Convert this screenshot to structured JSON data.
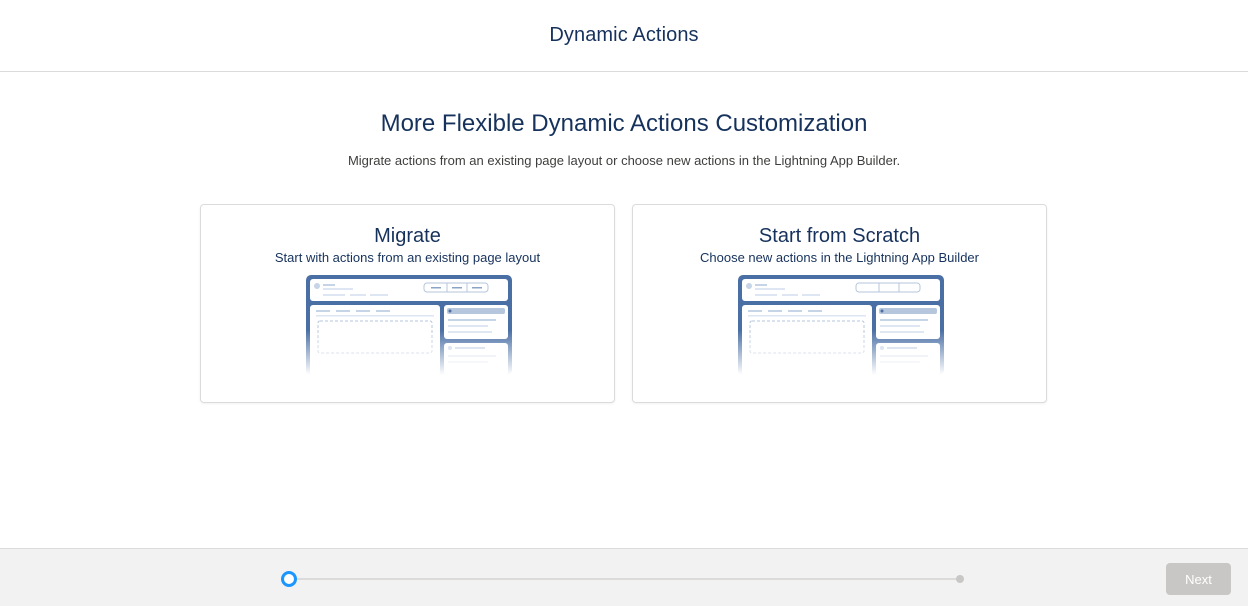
{
  "header": {
    "title": "Dynamic Actions"
  },
  "main": {
    "title": "More Flexible Dynamic Actions Customization",
    "subtitle": "Migrate actions from an existing page layout or choose new actions in the Lightning App Builder."
  },
  "cards": [
    {
      "title": "Migrate",
      "description": "Start with actions from an existing page layout"
    },
    {
      "title": "Start from Scratch",
      "description": "Choose new actions in the Lightning App Builder"
    }
  ],
  "footer": {
    "next_label": "Next",
    "current_step": 1,
    "total_steps": 2
  },
  "colors": {
    "title": "#16325c",
    "accent": "#1b96ff",
    "illustration_frame": "#4a6fa5",
    "disabled_button": "#c9c7c5"
  },
  "icons": [
    "page-layout-illustration",
    "page-layout-illustration"
  ]
}
